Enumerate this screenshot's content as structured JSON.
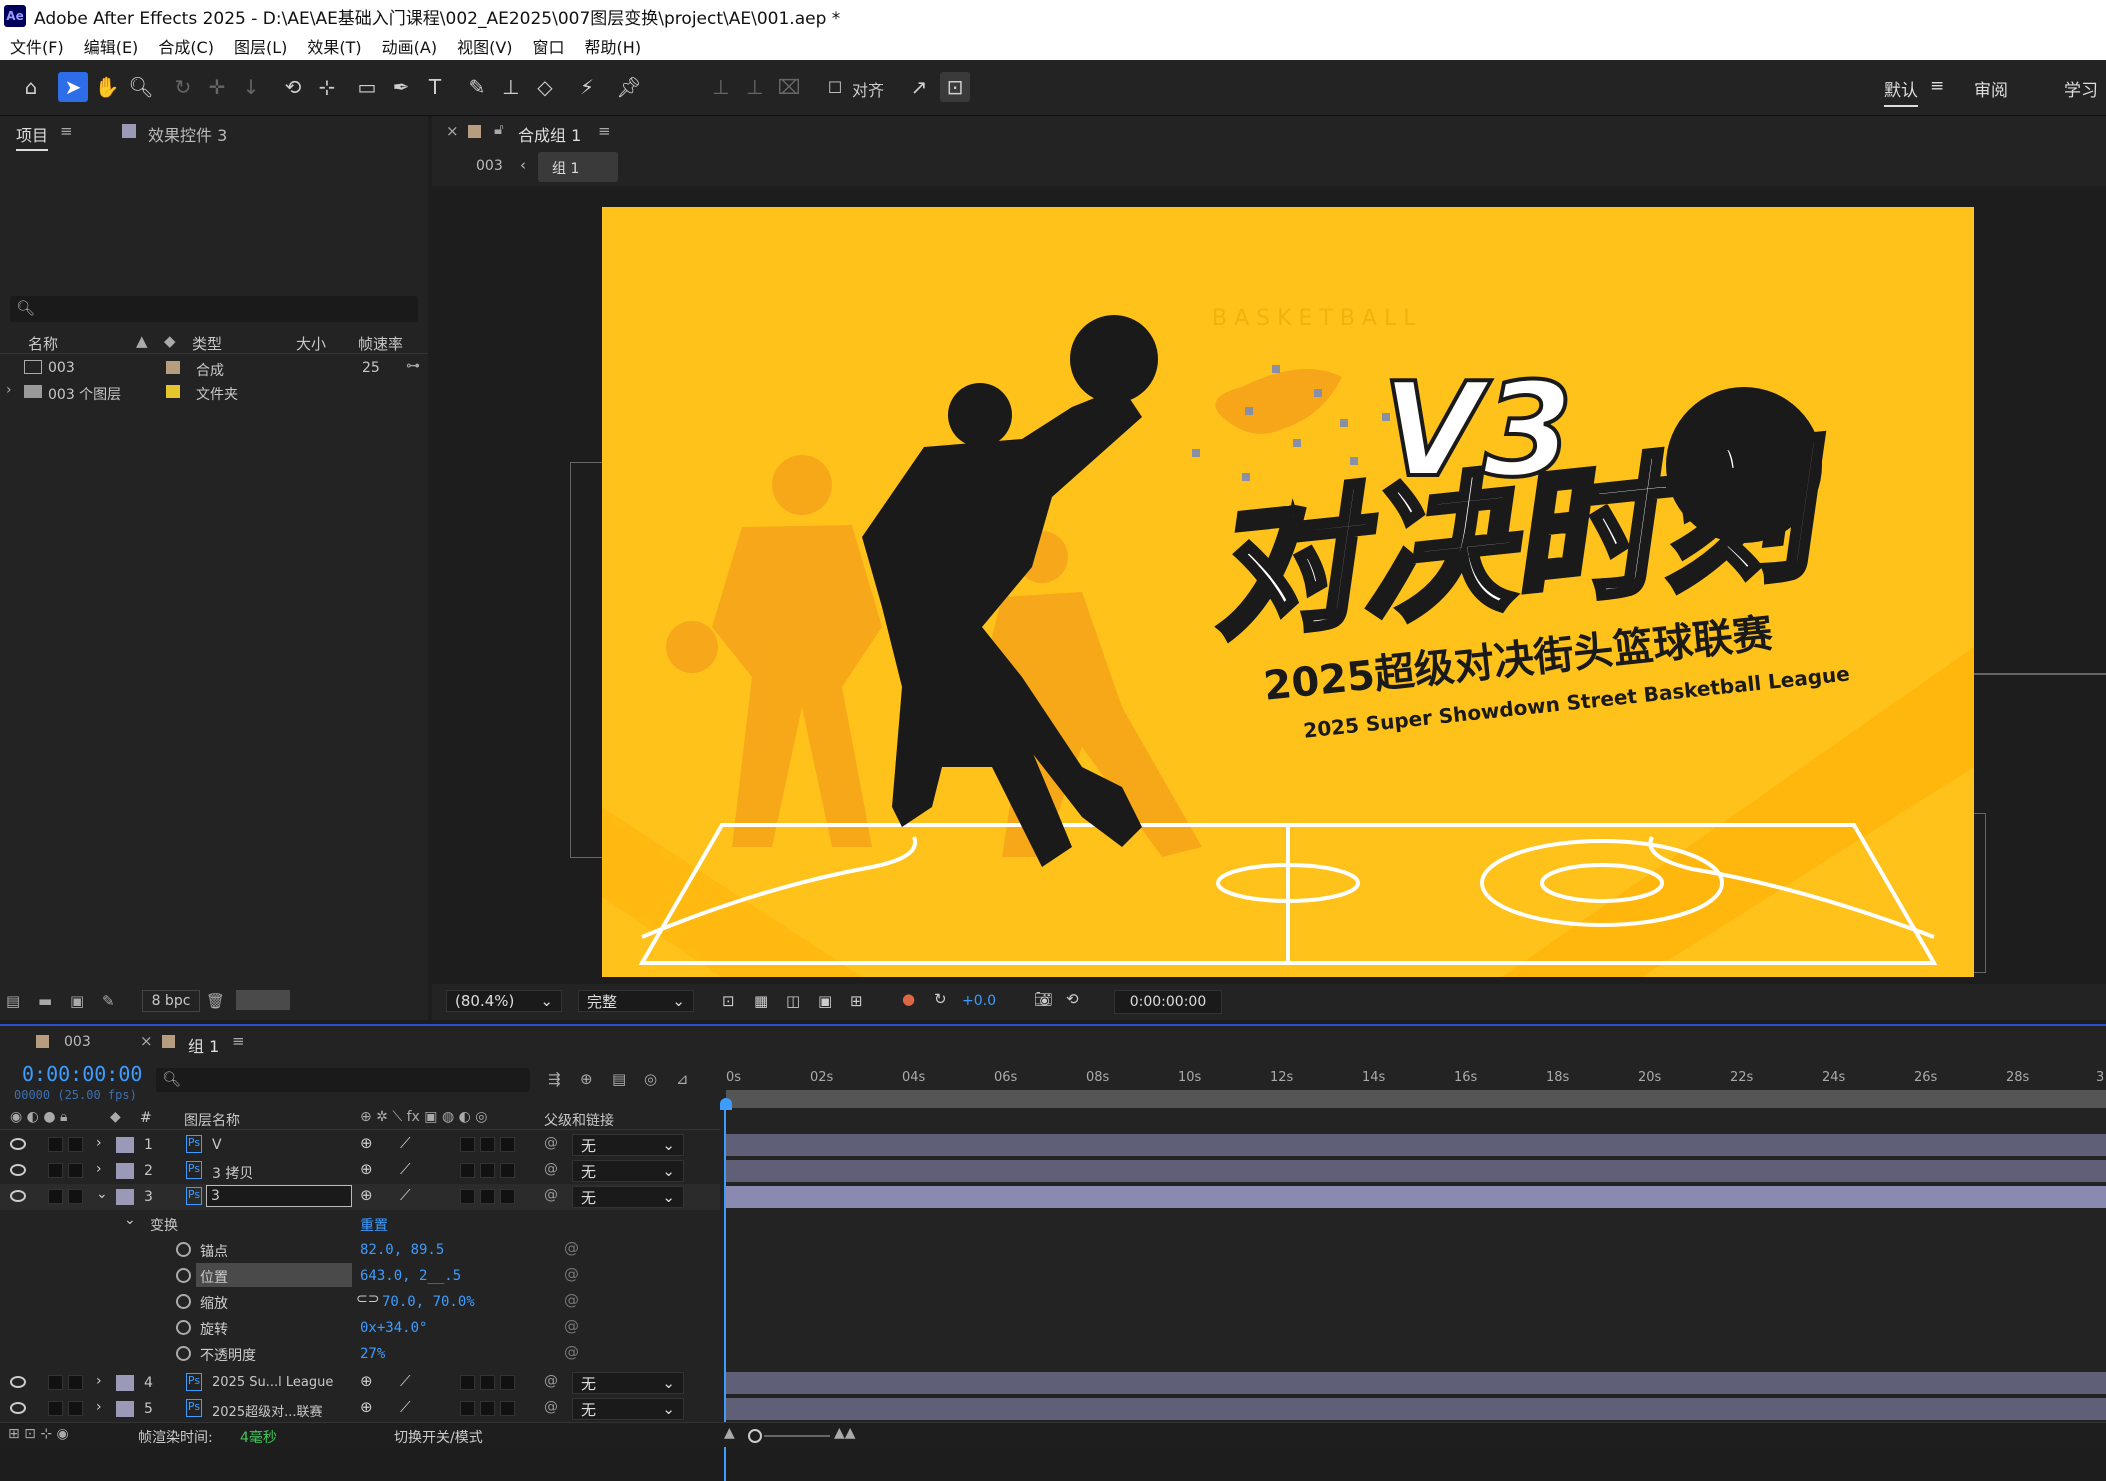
{
  "window": {
    "title": "Adobe After Effects 2025 - D:\\AE\\AE基础入门课程\\002_AE2025\\007图层变换\\project\\AE\\001.aep *",
    "logo": "Ae"
  },
  "menu": [
    "文件(F)",
    "编辑(E)",
    "合成(C)",
    "图层(L)",
    "效果(T)",
    "动画(A)",
    "视图(V)",
    "窗口",
    "帮助(H)"
  ],
  "toolbar": {
    "align_label": "对齐",
    "workspaces": [
      "默认",
      "审阅",
      "学习"
    ],
    "workspace_menu_icon": "≡"
  },
  "project_panel": {
    "tabs": [
      "项目",
      "效果控件 3"
    ],
    "search_placeholder": "",
    "columns": [
      "名称",
      "类型",
      "大小",
      "帧速率"
    ],
    "items": [
      {
        "name": "003",
        "type": "合成",
        "size": "",
        "fps": "25",
        "color": "#b79d7f"
      },
      {
        "name": "003 个图层",
        "type": "文件夹",
        "size": "",
        "fps": "",
        "color": "#e6c62e"
      }
    ],
    "bpc": "8 bpc"
  },
  "comp_panel": {
    "tab": "合成组 1",
    "breadcrumb": [
      "003",
      "组 1"
    ],
    "zoom": "(80.4%)",
    "resolution": "完整",
    "exposure": "+0.0",
    "timecode": "0:00:00:00"
  },
  "artwork": {
    "watermark": "B A S K E T B A L L",
    "v3": "V3",
    "headline": "对决时刻",
    "subtitle_cn": "2025超级对决街头篮球联赛",
    "subtitle_en": "2025 Super Showdown Street Basketball League",
    "bg_color": "#ffc21a"
  },
  "timeline": {
    "tabs": [
      "003",
      "组 1"
    ],
    "timecode": "0:00:00:00",
    "frame_info": "00000 (25.00 fps)",
    "columns": {
      "layer_name": "图层名称",
      "num": "#",
      "parent": "父级和链接"
    },
    "ruler": [
      "0s",
      "02s",
      "04s",
      "06s",
      "08s",
      "10s",
      "12s",
      "14s",
      "16s",
      "18s",
      "20s",
      "22s",
      "24s",
      "26s",
      "28s",
      "3"
    ],
    "layers": [
      {
        "num": "1",
        "name": "V",
        "parent": "无"
      },
      {
        "num": "2",
        "name": "3 拷贝",
        "parent": "无"
      },
      {
        "num": "3",
        "name": "3",
        "parent": "无"
      }
    ],
    "transform": {
      "label": "变换",
      "reset": "重置"
    },
    "props": [
      {
        "name": "锚点",
        "value": "82.0, 89.5"
      },
      {
        "name": "位置",
        "value": "643.0, 2__.5"
      },
      {
        "name": "缩放",
        "value": "70.0, 70.0%"
      },
      {
        "name": "旋转",
        "value": "0x+34.0°"
      },
      {
        "name": "不透明度",
        "value": "27%"
      }
    ],
    "layers_after": [
      {
        "num": "4",
        "name": "2025 Su...l League",
        "parent": "无"
      },
      {
        "num": "5",
        "name": "2025超级对...联赛",
        "parent": "无"
      }
    ],
    "footer": {
      "render_label": "帧渲染时间:",
      "render_value": "4毫秒",
      "toggle_label": "切换开关/模式"
    }
  }
}
